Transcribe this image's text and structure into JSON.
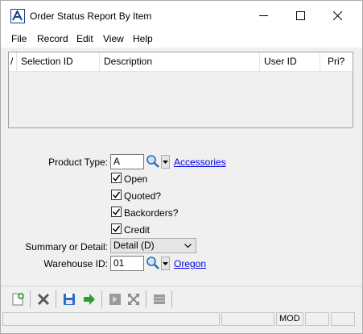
{
  "window": {
    "title": "Order Status Report By Item"
  },
  "titlebar": {
    "minimize_icon": "minimize-icon",
    "maximize_icon": "maximize-icon",
    "close_icon": "close-icon"
  },
  "menu": [
    "File",
    "Record",
    "Edit",
    "View",
    "Help"
  ],
  "grid": {
    "sort_marker": "/",
    "columns": [
      "Selection ID",
      "Description",
      "User ID",
      "Pri?"
    ],
    "rows": []
  },
  "form": {
    "product_type": {
      "label": "Product Type:",
      "value": "A",
      "link": "Accessories"
    },
    "checkboxes": [
      {
        "label": "Open",
        "checked": true
      },
      {
        "label": "Quoted?",
        "checked": true
      },
      {
        "label": "Backorders?",
        "checked": true
      },
      {
        "label": "Credit",
        "checked": true
      }
    ],
    "summary_or_detail": {
      "label": "Summary or Detail:",
      "value": "Detail (D)"
    },
    "warehouse_id": {
      "label": "Warehouse ID:",
      "value": "01",
      "link": "Oregon"
    }
  },
  "toolbar": [
    "new-record-icon",
    "delete-icon",
    "save-icon",
    "go-arrow-icon",
    "first-record-icon",
    "expand-icon",
    "list-icon"
  ],
  "statusbar": {
    "panes": [
      "",
      "",
      "MOD",
      "",
      ""
    ]
  },
  "colors": {
    "link": "#0000ee",
    "accent": "#1a3f8f",
    "go_arrow": "#2e9e2e"
  }
}
